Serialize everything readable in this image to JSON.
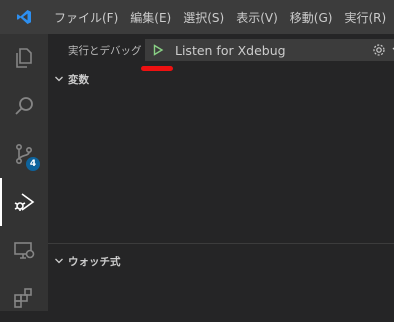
{
  "menu": {
    "items": [
      "ファイル(F)",
      "編集(E)",
      "選択(S)",
      "表示(V)",
      "移動(G)",
      "実行(R)"
    ]
  },
  "activity_bar": {
    "icons": [
      "explorer-icon",
      "search-icon",
      "source-control-icon",
      "run-debug-icon",
      "remote-explorer-icon",
      "extensions-icon"
    ],
    "source_control_badge": "4",
    "active": "run-debug-icon"
  },
  "debug": {
    "title": "実行とデバッグ",
    "configuration": "Listen for Xdebug",
    "sections": {
      "variables": "変数",
      "watch": "ウォッチ式"
    }
  },
  "colors": {
    "accent_play": "#89d185",
    "annotation": "#ee1111",
    "badge": "#0e639c"
  }
}
